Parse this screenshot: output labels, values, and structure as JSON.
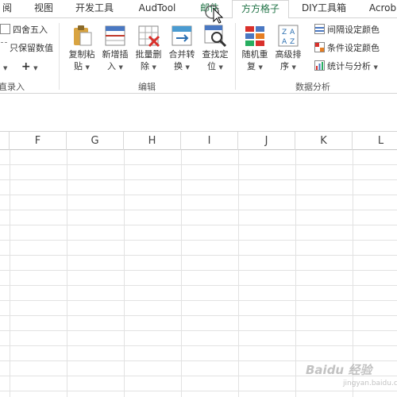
{
  "tabs": [
    {
      "label": "阅"
    },
    {
      "label": "视图"
    },
    {
      "label": "开发工具"
    },
    {
      "label": "AudTool"
    },
    {
      "label": "邮件"
    },
    {
      "label": "方方格子"
    },
    {
      "label": "DIY工具箱"
    },
    {
      "label": "Acrob"
    }
  ],
  "ribbon": {
    "left_group": {
      "row1": "四舍五入",
      "row2": "只保留数值",
      "row3_plus": "+",
      "label": "直录入"
    },
    "edit_group": {
      "label": "编辑",
      "buttons": [
        {
          "line1": "复制粘",
          "line2": "贴"
        },
        {
          "line1": "新增插",
          "line2": "入"
        },
        {
          "line1": "批量删",
          "line2": "除"
        },
        {
          "line1": "合并转",
          "line2": "换"
        },
        {
          "line1": "查找定",
          "line2": "位"
        }
      ]
    },
    "data_group": {
      "label": "数据分析",
      "buttons": [
        {
          "line1": "随机重",
          "line2": "复"
        },
        {
          "line1": "高级排",
          "line2": "序"
        }
      ],
      "small": [
        {
          "label": "间隔设定颜色"
        },
        {
          "label": "条件设定颜色"
        },
        {
          "label": "统计与分析"
        }
      ]
    }
  },
  "columns": [
    "F",
    "G",
    "H",
    "I",
    "J",
    "K",
    "L"
  ],
  "watermark": {
    "text": "Baidu 经验",
    "sub": "jingyan.baidu.com"
  }
}
